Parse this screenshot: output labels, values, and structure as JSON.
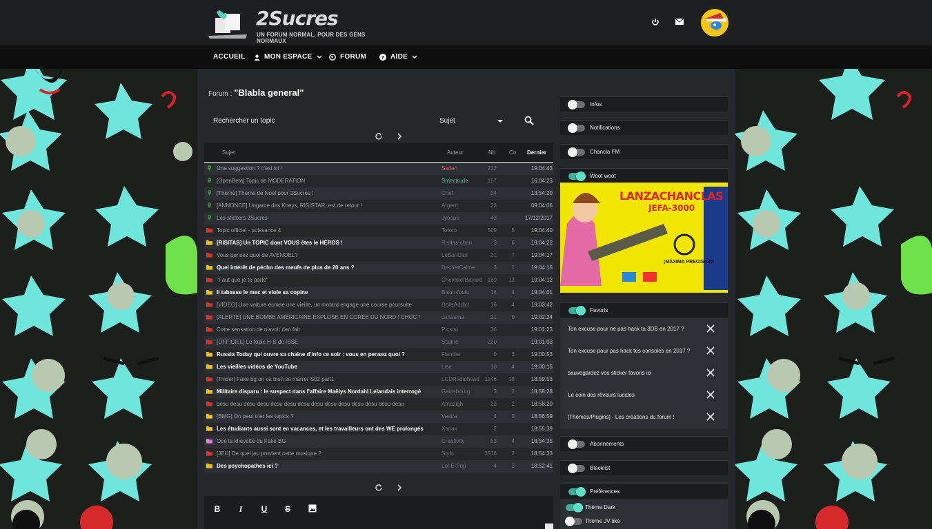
{
  "header": {
    "logo_title": "2Sucres",
    "logo_subtitle": "UN FORUM NORMAL, POUR DES GENS NORMAUX"
  },
  "nav": {
    "items": [
      {
        "label": "ACCUEIL"
      },
      {
        "label": "MON ESPACE"
      },
      {
        "label": "FORUM"
      },
      {
        "label": "AIDE"
      }
    ]
  },
  "forum": {
    "prefix": "Forum : ",
    "name": "\"Blabla general\""
  },
  "search": {
    "label": "Rechercher un topic",
    "select_value": "Sujet"
  },
  "table": {
    "columns": {
      "subject": "Sujet",
      "author": "Auteur",
      "nb": "Nb",
      "co": "Co",
      "last": "Dernier"
    },
    "rows": [
      {
        "icon": "pin",
        "subject": "Une suggestion ? c'est ici !",
        "author": "Saden",
        "author_color": "#e05b4b",
        "nb": "222",
        "co": "",
        "last": "19:04:43",
        "bold": false
      },
      {
        "icon": "pin",
        "subject": "[OpenBeta] Topic de MODERATION",
        "author": "Smectrude",
        "author_color": "#3fc59a",
        "nb": "157",
        "co": "",
        "last": "16:04:23",
        "bold": false
      },
      {
        "icon": "pin",
        "subject": "[Theme] Theme de Noel pour 2Sucres !",
        "author": "Chef",
        "author_color": "",
        "nb": "34",
        "co": "",
        "last": "13:54:20",
        "bold": false
      },
      {
        "icon": "pin",
        "subject": "[ANNONCE] Uogame des Kheys, RISISTAR, est de retour !",
        "author": "Argent",
        "author_color": "",
        "nb": "23",
        "co": "",
        "last": "09:04:06",
        "bold": false
      },
      {
        "icon": "pin",
        "subject": "Les stickers 2Sucres",
        "author": "Jyoopo",
        "author_color": "",
        "nb": "43",
        "co": "",
        "last": "17/12/2017",
        "bold": false
      },
      {
        "icon": "red",
        "subject": "Topic officiel - puissance 4",
        "author": "Totoro",
        "author_color": "",
        "nb": "509",
        "co": "5",
        "last": "19:04:40",
        "bold": false
      },
      {
        "icon": "yellow",
        "subject": "[RISITAS] Un TOPIC dont VOUS êtes le HÉROS !",
        "author": "Risitas-chan",
        "author_color": "",
        "nb": "3",
        "co": "6",
        "last": "19:04:22",
        "bold": true
      },
      {
        "icon": "red",
        "subject": "Vous pensez quoi de AVENOEL?",
        "author": "LeBonCarl",
        "author_color": "",
        "nb": "21",
        "co": "7",
        "last": "19:04:17",
        "bold": false
      },
      {
        "icon": "yellow",
        "subject": "Quel intérêt de pécho des meufs de plus de 20 ans ?",
        "author": "DechetCalme",
        "author_color": "",
        "nb": "3",
        "co": "1",
        "last": "19:04:15",
        "bold": true
      },
      {
        "icon": "red",
        "subject": "\"Faut que je te parle\"",
        "author": "ChevalierBayard",
        "author_color": "",
        "nb": "189",
        "co": "13",
        "last": "19:04:12",
        "bold": false
      },
      {
        "icon": "yellow",
        "subject": "Il tabasse le mec et viole sa copine",
        "author": "Bison-foutu",
        "author_color": "",
        "nb": "14",
        "co": "4",
        "last": "19:04:01",
        "bold": true
      },
      {
        "icon": "red",
        "subject": "[VIDEO] Une voiture écrase une vieille, un motard engage une course poursuite",
        "author": "DollsAddict",
        "author_color": "",
        "nb": "16",
        "co": "4",
        "last": "19:03:42",
        "bold": false
      },
      {
        "icon": "red",
        "subject": "[ALERTE] UNE BOMBE AMÉRICAINE EXPLOSE EN CORÉE DU NORD ! CHOC !",
        "author": "carlaema",
        "author_color": "",
        "nb": "21",
        "co": "9",
        "last": "19:02:24",
        "bold": false
      },
      {
        "icon": "red",
        "subject": "Cette sensation de n'avoir rien fait",
        "author": "Picsou",
        "author_color": "",
        "nb": "36",
        "co": "",
        "last": "19:01:23",
        "bold": false
      },
      {
        "icon": "red",
        "subject": "[OFFICIEL] Le topic H-S de ISSE",
        "author": "Staline",
        "author_color": "",
        "nb": "220",
        "co": "",
        "last": "19:01:03",
        "bold": false
      },
      {
        "icon": "yellow",
        "subject": "Russia Today qui ouvre sa chaine d'info ce soir : vous en pensez quoi ?",
        "author": "Flandre",
        "author_color": "",
        "nb": "0",
        "co": "3",
        "last": "19:00:53",
        "bold": true
      },
      {
        "icon": "yellow",
        "subject": "Les vieilles vidéos de YouTube",
        "author": "Lisa",
        "author_color": "",
        "nb": "10",
        "co": "4",
        "last": "19:00:15",
        "bold": true
      },
      {
        "icon": "red",
        "subject": "[Tinder] Fake bg on va bien se marrer S02 part1",
        "author": "LCDRadiohead",
        "author_color": "",
        "nb": "1146",
        "co": "18",
        "last": "18:59:53",
        "bold": false
      },
      {
        "icon": "yellow",
        "subject": "Militaire disparu : le suspect dans l'affaire Maëlys Nordahl Lelandais interrogé",
        "author": "Gainsbourg",
        "author_color": "",
        "nb": "3",
        "co": "2",
        "last": "18:58:28",
        "bold": true
      },
      {
        "icon": "red",
        "subject": "desu desu desu desu desu desu desu desu desu desu desu desu desu desu",
        "author": "Amazigh",
        "author_color": "",
        "nb": "23",
        "co": "2",
        "last": "18:58:20",
        "bold": false
      },
      {
        "icon": "yellow",
        "subject": "[BMG] On peut trier les topics ?",
        "author": "Vestra",
        "author_color": "",
        "nb": "4",
        "co": "3",
        "last": "18:56:59",
        "bold": false
      },
      {
        "icon": "yellow",
        "subject": "Les étudiants aussi sont en vacances, et les travailleurs ont des WE prolongés",
        "author": "Xanax",
        "author_color": "",
        "nb": "2",
        "co": "",
        "last": "18:55:39",
        "bold": true
      },
      {
        "icon": "pink",
        "subject": "Océ la kheyette du Fake BG",
        "author": "Creativity",
        "author_color": "",
        "nb": "53",
        "co": "4",
        "last": "18:54:35",
        "bold": false
      },
      {
        "icon": "red",
        "subject": "[JEU] De quel jeu provient cette musique ?",
        "author": "Stylo",
        "author_color": "",
        "nb": "3576",
        "co": "2",
        "last": "18:54:33",
        "bold": false
      },
      {
        "icon": "yellow",
        "subject": "Des psychopathes ici ?",
        "author": "Lol-E-Pop",
        "author_color": "",
        "nb": "4",
        "co": "3",
        "last": "18:52:41",
        "bold": true
      }
    ]
  },
  "sidebar": {
    "widgets": [
      {
        "label": "Infos",
        "on": false
      },
      {
        "label": "Notifications",
        "on": false
      },
      {
        "label": "Chancla FM",
        "on": false
      },
      {
        "label": "Woot woot",
        "on": true
      },
      {
        "label": "Favoris",
        "on": true
      },
      {
        "label": "Abonnements",
        "on": false
      },
      {
        "label": "Blacklist",
        "on": false
      },
      {
        "label": "Préférences",
        "on": true
      }
    ],
    "woot_image": {
      "headline": "LANZACHANCLAS",
      "subline": "JEFA-3000",
      "tag": "¡MÁXIMA PRECISIÓN!"
    },
    "favorites": [
      "Ton excuse pour ne pas hack ta 3DS en 2017 ?",
      "Ton excuse pour pas hack tes consoles en 2017 ?",
      "sauvegardez vos sticker favoris ici",
      "Le coin des rêveurs lucides",
      "[Thèmes/Plugins] - Les créations du forum !"
    ],
    "preferences": [
      {
        "label": "Thème Dark",
        "on": true
      },
      {
        "label": "Thème JV-like",
        "on": false
      }
    ]
  },
  "editor": {
    "buttons": [
      "B",
      "I",
      "U",
      "S",
      "image"
    ]
  },
  "colors": {
    "accent": "#3fae9a",
    "folder_red": "#d9342b",
    "folder_yellow": "#f4c20d",
    "folder_pink": "#e57ad8",
    "pin_green": "#2a9a2a"
  }
}
